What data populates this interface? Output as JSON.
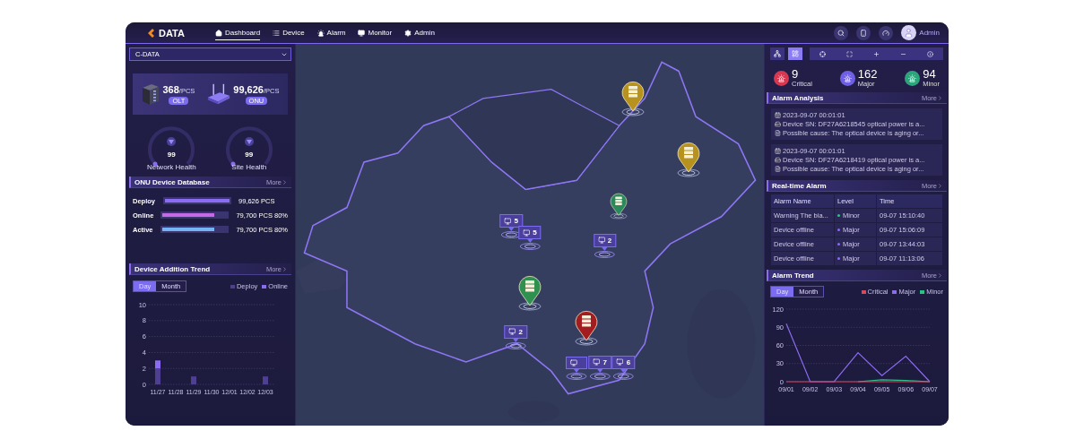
{
  "header": {
    "logo": "DATA",
    "nav": [
      {
        "label": "Dashboard",
        "selected": true
      },
      {
        "label": "Device",
        "selected": false
      },
      {
        "label": "Alarm",
        "selected": false
      },
      {
        "label": "Monitor",
        "selected": false
      },
      {
        "label": "Admin",
        "selected": false
      }
    ],
    "user": "Admin"
  },
  "left": {
    "site_select": "C-DATA",
    "devices": [
      {
        "kind": "olt",
        "count": "368",
        "unit": "/PCS",
        "tag": "OLT"
      },
      {
        "kind": "onu",
        "count": "99,626",
        "unit": "/PCS",
        "tag": "ONU"
      }
    ],
    "health": [
      {
        "value": "99",
        "label": "Network Health"
      },
      {
        "value": "99",
        "label": "Site Health"
      }
    ],
    "onu_database": {
      "title": "ONU Device Database",
      "more": "More",
      "rows": [
        {
          "label": "Deploy",
          "level": 1,
          "color": "#8b6cf0",
          "value": "99,626 PCS"
        },
        {
          "label": "Online",
          "level": 0.8,
          "color": "#c46ae6",
          "value": "79,700 PCS 80%"
        },
        {
          "label": "Active",
          "level": 0.8,
          "color": "#74b4f2",
          "value": "79,700 PCS 80%"
        }
      ]
    },
    "addition_trend": {
      "title": "Device Addition Trend",
      "more": "More",
      "tabs": [
        {
          "label": "Day",
          "selected": true
        },
        {
          "label": "Month",
          "selected": false
        }
      ],
      "chart_data": {
        "type": "bar",
        "categories": [
          "11/27",
          "11/28",
          "11/29",
          "11/30",
          "12/01",
          "12/02",
          "12/03"
        ],
        "stacked": true,
        "grid": true,
        "ylim": [
          0,
          10
        ],
        "yticks": [
          0,
          2,
          4,
          6,
          8,
          10
        ],
        "series": [
          {
            "name": "Deploy",
            "color": "#4e3f92",
            "values": [
              2,
              0,
              1,
              0,
              0,
              0,
              1
            ]
          },
          {
            "name": "Online",
            "color": "#8b6cf0",
            "values": [
              1,
              0,
              0,
              0,
              0,
              0,
              0
            ]
          }
        ]
      }
    }
  },
  "map": {
    "markers": [
      {
        "kind": "pin",
        "color": "#b8921f"
      },
      {
        "kind": "pin",
        "color": "#b8921f"
      },
      {
        "kind": "pin",
        "color": "#2b8a5c"
      },
      {
        "kind": "cluster",
        "count": "5"
      },
      {
        "kind": "cluster",
        "count": "5"
      },
      {
        "kind": "cluster",
        "count": "2"
      },
      {
        "kind": "pin",
        "color": "#2e9150"
      },
      {
        "kind": "pin",
        "color": "#a31c1f"
      },
      {
        "kind": "cluster",
        "count": "2"
      },
      {
        "kind": "cluster"
      },
      {
        "kind": "cluster",
        "count": "7"
      },
      {
        "kind": "cluster",
        "count": "6"
      }
    ]
  },
  "right": {
    "views": [
      {
        "selected": false
      },
      {
        "selected": true
      }
    ],
    "alarm_counts": [
      {
        "count": "9",
        "label": "Critical",
        "color": "#d9364f"
      },
      {
        "count": "162",
        "label": "Major",
        "color": "#6f5fe8"
      },
      {
        "count": "94",
        "label": "Minor",
        "color": "#2aa57c"
      }
    ],
    "alarm_analysis": {
      "title": "Alarm Analysis",
      "more": "More",
      "items": [
        {
          "time": "2023-09-07 00:01:01",
          "device": "Device SN: DF27A6218545 optical power is a...",
          "cause": "Possible cause: The optical device is aging or..."
        },
        {
          "time": "2023-09-07 00:01:01",
          "device": "Device SN: DF27A6218419 optical power is a...",
          "cause": "Possible cause: The optical device is aging or..."
        }
      ]
    },
    "realtime_alarm": {
      "title": "Real-time Alarm",
      "more": "More",
      "columns": [
        "Alarm Name",
        "Level",
        "Time"
      ],
      "rows": [
        {
          "name": "Warning The bia...",
          "level": "Minor",
          "color": "#2fc08a",
          "time": "09-07 15:10:40"
        },
        {
          "name": "Device offline",
          "level": "Major",
          "color": "#8b6cf0",
          "time": "09-07 15:06:09"
        },
        {
          "name": "Device offline",
          "level": "Major",
          "color": "#8b6cf0",
          "time": "09-07 13:44:03"
        },
        {
          "name": "Device offline",
          "level": "Major",
          "color": "#8b6cf0",
          "time": "09-07 11:13:06"
        }
      ]
    },
    "alarm_trend": {
      "title": "Alarm Trend",
      "more": "More",
      "tabs": [
        {
          "label": "Day",
          "selected": true
        },
        {
          "label": "Month",
          "selected": false
        }
      ],
      "chart_data": {
        "type": "line",
        "categories": [
          "09/01",
          "09/02",
          "09/03",
          "09/04",
          "09/05",
          "09/06",
          "09/07"
        ],
        "grid": true,
        "ylim": [
          0,
          120
        ],
        "yticks": [
          0,
          30,
          60,
          90,
          120
        ],
        "series": [
          {
            "name": "Critical",
            "color": "#e0455a",
            "values": [
              0,
              0,
              0,
              0,
              0,
              0,
              0
            ]
          },
          {
            "name": "Major",
            "color": "#8b6cf0",
            "values": [
              96,
              0,
              0,
              48,
              10,
              42,
              0
            ]
          },
          {
            "name": "Minor",
            "color": "#2fc08a",
            "values": [
              null,
              null,
              null,
              0,
              3,
              2,
              0
            ]
          }
        ]
      }
    }
  }
}
